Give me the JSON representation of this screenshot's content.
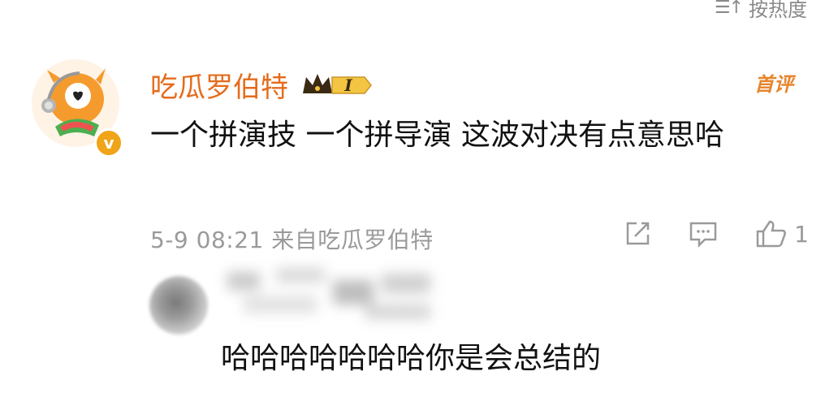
{
  "header": {
    "sort_label": "按热度",
    "sort_icon": "sort-icon"
  },
  "comment": {
    "username": "吃瓜罗伯特",
    "vip_level": "I",
    "vip_badge_icon": "crown-icon",
    "verified_badge": "v",
    "pin_label": "首评",
    "text": "一个拼演技 一个拼导演 这波对决有点意思哈",
    "meta": "5-9 08:21 来自吃瓜罗伯特",
    "actions": {
      "share_icon": "share-icon",
      "comment_icon": "comment-icon",
      "like_icon": "like-icon",
      "like_count": "1"
    }
  },
  "reply": {
    "text": "哈哈哈哈哈哈哈你是会总结的"
  },
  "colors": {
    "username": "#e56c1c",
    "pin": "#e6852b",
    "meta": "#9a9a9a",
    "badge": "#f0a417"
  }
}
